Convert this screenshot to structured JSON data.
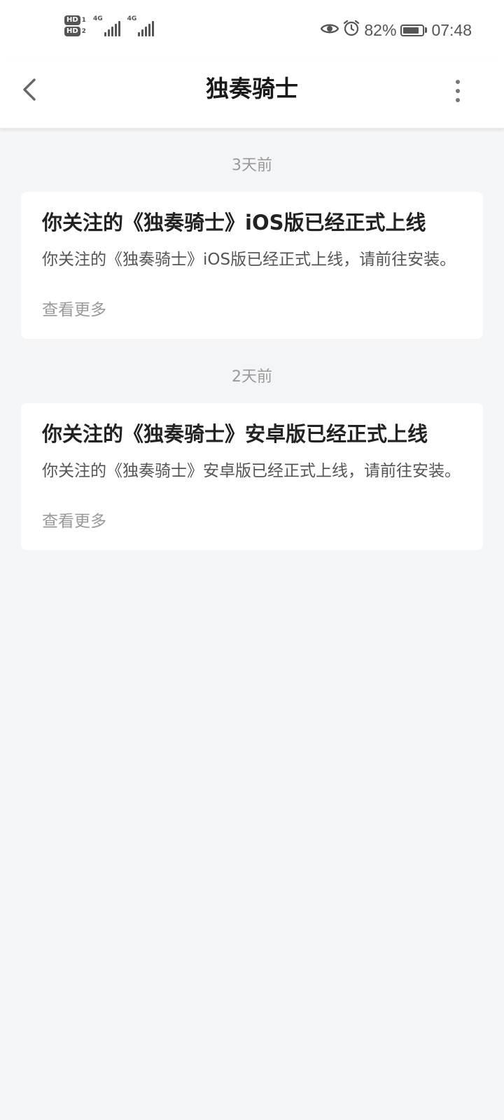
{
  "status_bar": {
    "hd1": "HD",
    "hd1_index": "1",
    "hd2": "HD",
    "hd2_index": "2",
    "sim1_network": "4G",
    "sim2_network": "4G",
    "battery_percent": "82%",
    "battery_level": 0.82,
    "time": "07:48",
    "icons": [
      "eye-icon",
      "alarm-icon",
      "battery-icon",
      "signal-icon"
    ]
  },
  "nav": {
    "title": "独奏骑士",
    "back_icon": "chevron-left-icon",
    "more_icon": "more-vertical-icon"
  },
  "messages": [
    {
      "time": "3天前",
      "title": "你关注的《独奏骑士》iOS版已经正式上线",
      "body": "你关注的《独奏骑士》iOS版已经正式上线，请前往安装。",
      "more": "查看更多"
    },
    {
      "time": "2天前",
      "title": "你关注的《独奏骑士》安卓版已经正式上线",
      "body": "你关注的《独奏骑士》安卓版已经正式上线，请前往安装。",
      "more": "查看更多"
    }
  ],
  "colors": {
    "page_background": "#f4f5f7",
    "card_background": "#ffffff",
    "title_text": "#222222",
    "muted_text": "#999999"
  }
}
